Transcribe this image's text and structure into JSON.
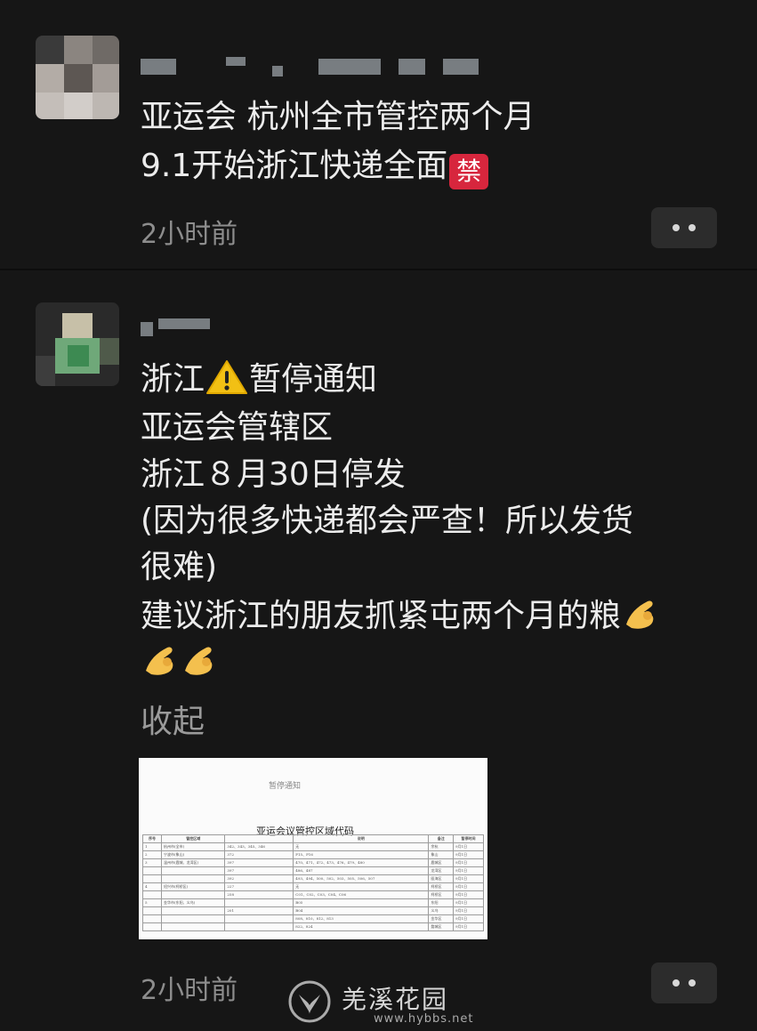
{
  "post1": {
    "lines": [
      "亚运会 杭州全市管控两个月",
      "9.1开始浙江快递全面"
    ],
    "ban_emoji": "禁",
    "time": "2小时前"
  },
  "post2": {
    "line1_a": "浙江",
    "line1_b": "暂停通知",
    "line2": "亚运会管辖区",
    "line3": "浙江８月30日停发",
    "line4": "(因为很多快递都会严查！所以发货",
    "line5": "很难)",
    "line6": "建议浙江的朋友抓紧屯两个月的粮",
    "collapse": "收起",
    "time": "2小时前",
    "attachment": {
      "header": "暂停通知",
      "title": "亚运会议管控区域代码",
      "columns": [
        "序号",
        "管控区域",
        "",
        "说明",
        "备注",
        "暂停时间"
      ],
      "rows": [
        [
          "1",
          "杭州市(全市)",
          "342、343、345、346",
          "无",
          "余杭",
          "9月1日"
        ],
        [
          "2",
          "宁波市(象山)",
          "372",
          "P15、P16",
          "象山",
          "9月1日"
        ],
        [
          "3",
          "温州市(鹿城、龙湾区)",
          "397",
          "470、471、472、473、476、479、480",
          "鹿城区",
          "9月1日"
        ],
        [
          "",
          "",
          "397",
          "486、487",
          "龙湾区",
          "9月1日"
        ],
        [
          "",
          "",
          "392",
          "493、494、500、502、503、505、506、507",
          "瓯海区",
          "9月1日"
        ],
        [
          "4",
          "绍兴市(柯桥区)",
          "227",
          "无",
          "柯桥区",
          "9月1日"
        ],
        [
          "",
          "",
          "258",
          "C01、C02、C03、C04、C06",
          "柯桥区",
          "9月1日"
        ],
        [
          "5",
          "金华市(东阳、义乌)",
          "",
          "B05",
          "东阳",
          "9月1日"
        ],
        [
          "",
          "",
          "201",
          "B04",
          "义乌",
          "9月1日"
        ],
        [
          "",
          "",
          "",
          "808、810、812、813",
          "金华区",
          "9月1日"
        ],
        [
          "",
          "",
          "",
          "822、824",
          "婺城区",
          "9月1日"
        ]
      ]
    }
  },
  "watermark": {
    "text": "羌溪花园",
    "url": "www.hybbs.net"
  },
  "colors": {
    "background": "#161616",
    "text": "#ececec",
    "muted": "#8d8d8d",
    "ban": "#d7263d"
  }
}
